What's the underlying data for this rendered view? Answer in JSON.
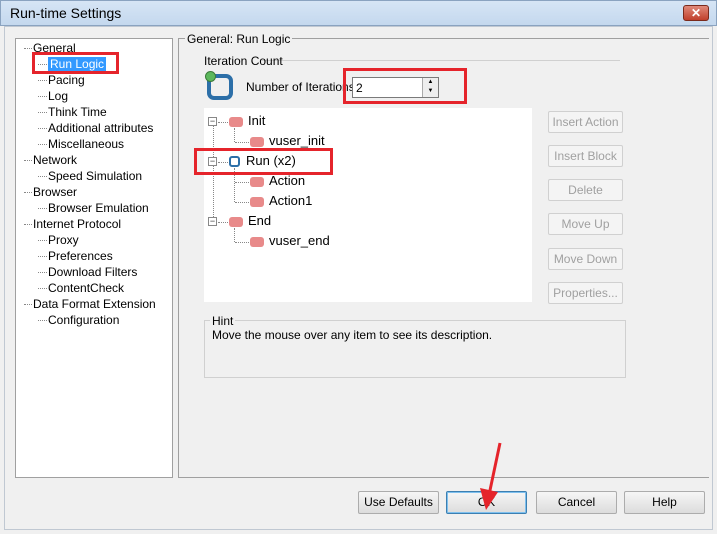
{
  "window": {
    "title": "Run-time Settings",
    "close_icon": "close-icon"
  },
  "sidebar": {
    "items": [
      {
        "label": "General",
        "level": 0
      },
      {
        "label": "Run Logic",
        "level": 1,
        "selected": true
      },
      {
        "label": "Pacing",
        "level": 1
      },
      {
        "label": "Log",
        "level": 1
      },
      {
        "label": "Think Time",
        "level": 1
      },
      {
        "label": "Additional attributes",
        "level": 1
      },
      {
        "label": "Miscellaneous",
        "level": 1
      },
      {
        "label": "Network",
        "level": 0
      },
      {
        "label": "Speed Simulation",
        "level": 1
      },
      {
        "label": "Browser",
        "level": 0
      },
      {
        "label": "Browser Emulation",
        "level": 1
      },
      {
        "label": "Internet Protocol",
        "level": 0
      },
      {
        "label": "Proxy",
        "level": 1
      },
      {
        "label": "Preferences",
        "level": 1
      },
      {
        "label": "Download Filters",
        "level": 1
      },
      {
        "label": "ContentCheck",
        "level": 1
      },
      {
        "label": "Data Format Extension",
        "level": 0
      },
      {
        "label": "Configuration",
        "level": 1
      }
    ]
  },
  "main": {
    "group_title": "General: Run Logic",
    "iteration_group": "Iteration Count",
    "iterations_label": "Number of Iterations",
    "iterations_value": "2",
    "tree": [
      {
        "label": "Init",
        "level": 0
      },
      {
        "label": "vuser_init",
        "level": 1
      },
      {
        "label": "Run (x2)",
        "level": 0
      },
      {
        "label": "Action",
        "level": 1
      },
      {
        "label": "Action1",
        "level": 1
      },
      {
        "label": "End",
        "level": 0
      },
      {
        "label": "vuser_end",
        "level": 1
      }
    ],
    "side_buttons": [
      "Insert Action",
      "Insert Block",
      "Delete",
      "Move Up",
      "Move Down",
      "Properties..."
    ],
    "hint_title": "Hint",
    "hint_text": "Move the mouse over any item to see its description."
  },
  "footer": {
    "use_defaults": "Use Defaults",
    "ok": "OK",
    "cancel": "Cancel",
    "help": "Help"
  },
  "annotation_color": "#e5242b"
}
